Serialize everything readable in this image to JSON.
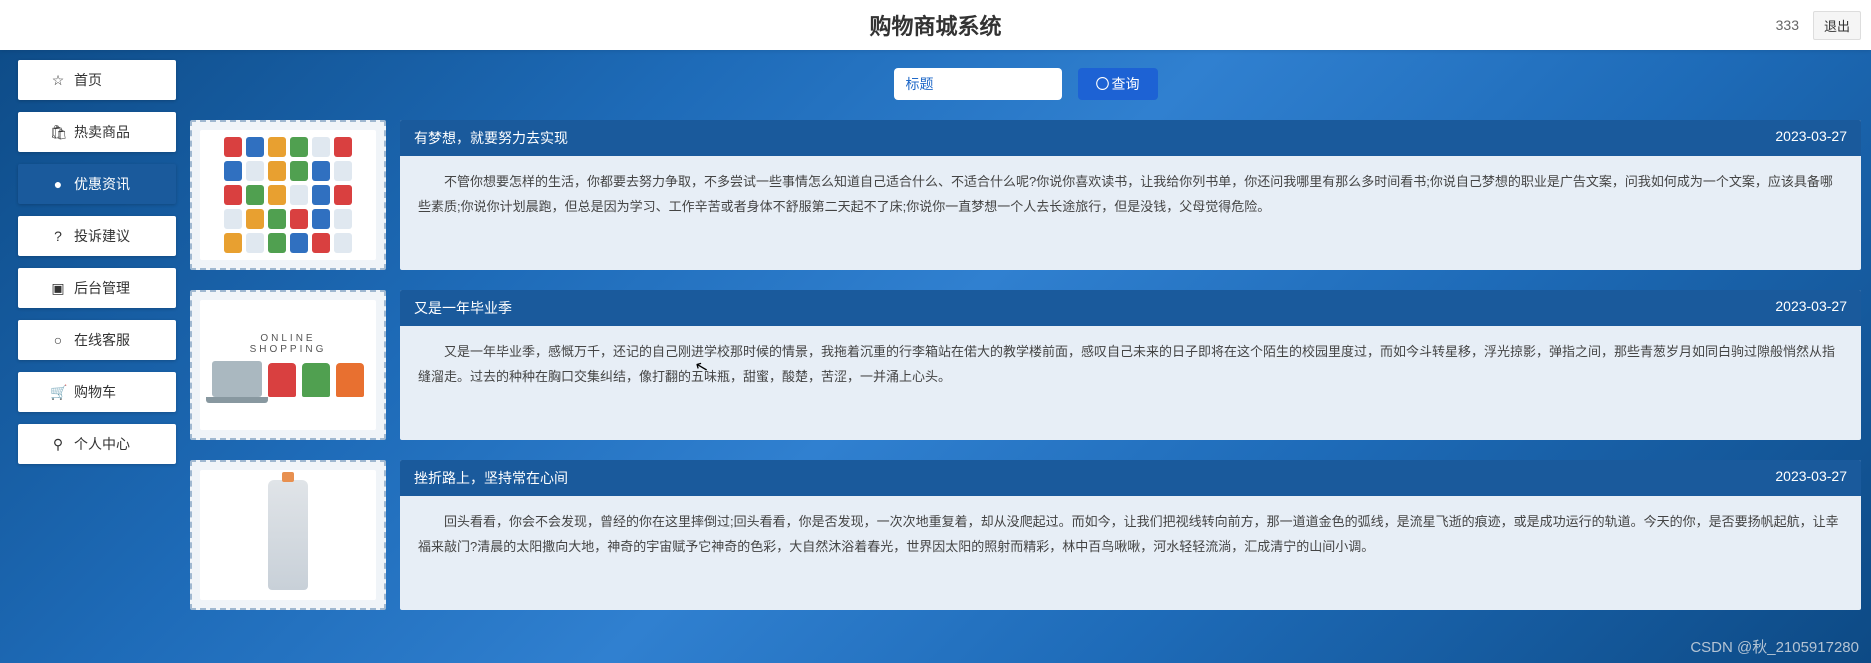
{
  "header": {
    "title": "购物商城系统",
    "user": "333",
    "logout": "退出"
  },
  "sidebar": {
    "items": [
      {
        "icon": "☆",
        "label": "首页",
        "name": "nav-home"
      },
      {
        "icon": "🛍",
        "label": "热卖商品",
        "name": "nav-hot"
      },
      {
        "icon": "●",
        "label": "优惠资讯",
        "name": "nav-news",
        "active": true
      },
      {
        "icon": "?",
        "label": "投诉建议",
        "name": "nav-feedback"
      },
      {
        "icon": "▣",
        "label": "后台管理",
        "name": "nav-admin"
      },
      {
        "icon": "○",
        "label": "在线客服",
        "name": "nav-service"
      },
      {
        "icon": "🛒",
        "label": "购物车",
        "name": "nav-cart"
      },
      {
        "icon": "⚲",
        "label": "个人中心",
        "name": "nav-profile"
      }
    ]
  },
  "search": {
    "placeholder": "标题",
    "button": "查询"
  },
  "articles": [
    {
      "title": "有梦想，就要努力去实现",
      "date": "2023-03-27",
      "body": "不管你想要怎样的生活，你都要去努力争取，不多尝试一些事情怎么知道自己适合什么、不适合什么呢?你说你喜欢读书，让我给你列书单，你还问我哪里有那么多时间看书;你说自己梦想的职业是广告文案，问我如何成为一个文案，应该具备哪些素质;你说你计划晨跑，但总是因为学习、工作辛苦或者身体不舒服第二天起不了床;你说你一直梦想一个人去长途旅行，但是没钱，父母觉得危险。"
    },
    {
      "title": "又是一年毕业季",
      "date": "2023-03-27",
      "body": "又是一年毕业季，感慨万千，还记的自己刚进学校那时候的情景，我拖着沉重的行李箱站在偌大的教学楼前面，感叹自己未来的日子即将在这个陌生的校园里度过，而如今斗转星移，浮光掠影，弹指之间，那些青葱岁月如同白驹过隙般悄然从指缝溜走。过去的种种在胸口交集纠结，像打翻的五味瓶，甜蜜，酸楚，苦涩，一并涌上心头。"
    },
    {
      "title": "挫折路上，坚持常在心间",
      "date": "2023-03-27",
      "body": "回头看看，你会不会发现，曾经的你在这里摔倒过;回头看看，你是否发现，一次次地重复着，却从没爬起过。而如今，让我们把视线转向前方，那一道道金色的弧线，是流星飞逝的痕迹，或是成功运行的轨道。今天的你，是否要扬帆起航，让幸福来敲门?清晨的太阳撒向大地，神奇的宇宙赋予它神奇的色彩，大自然沐浴着春光，世界因太阳的照射而精彩，林中百鸟啾啾，河水轻轻流淌，汇成清宁的山间小调。"
    }
  ],
  "watermark": "CSDN @秋_2105917280"
}
